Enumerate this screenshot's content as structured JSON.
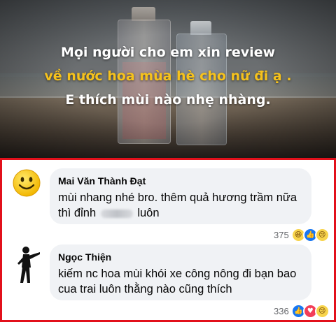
{
  "post_image": {
    "line1": "Mọi người cho em xin review",
    "line2": "về nước hoa mùa hè cho nữ đi ạ .",
    "line3": "E thích mùi nào nhẹ nhàng."
  },
  "comments": [
    {
      "author": "Mai Văn Thành Đạt",
      "text_before": "mùi nhang nhé bro. thêm quả hương trầm nữa thì đỉnh",
      "text_after": "luôn",
      "reaction_count": "375",
      "reactions": [
        "haha-icon",
        "like-icon",
        "sad-icon"
      ],
      "avatar": "smiley-face-icon"
    },
    {
      "author": "Ngọc Thiện",
      "text": "kiếm nc hoa mùi khói xe công nông đi bạn bao cua trai luôn thằng nào cũng thích",
      "reaction_count": "336",
      "reactions": [
        "like-icon",
        "love-icon",
        "sad-icon"
      ],
      "avatar": "pointing-silhouette-icon"
    }
  ],
  "colors": {
    "highlight_border": "#e2101b",
    "headline_yellow": "#f6c21c",
    "bubble_bg": "#f0f2f5",
    "like_blue": "#1877f2"
  }
}
